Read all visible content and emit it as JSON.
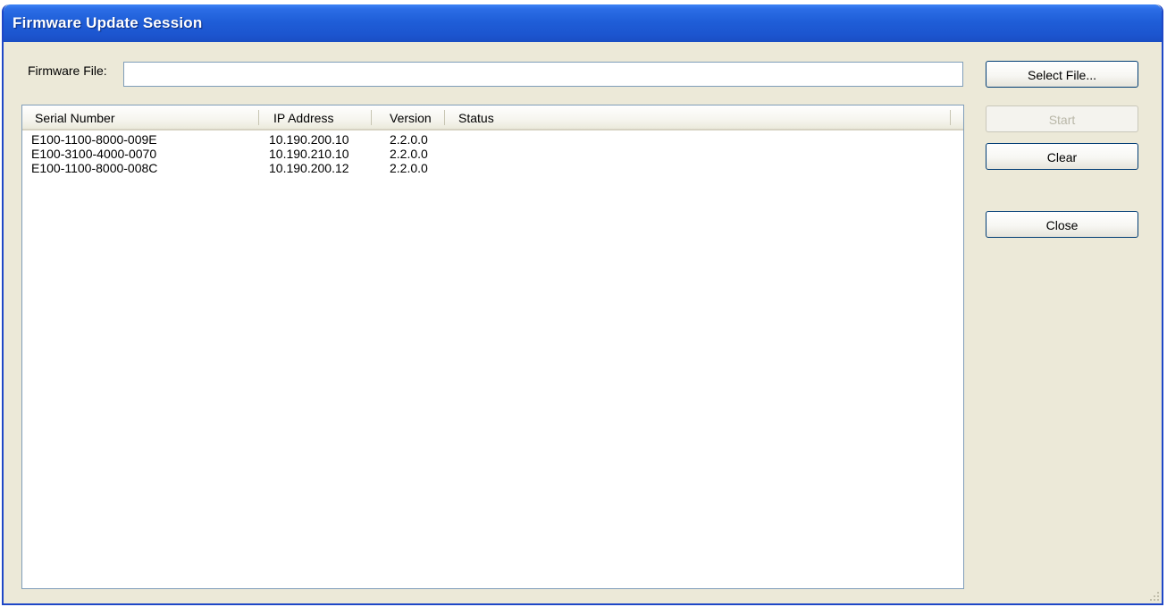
{
  "window": {
    "title": "Firmware Update Session"
  },
  "firmware": {
    "label": "Firmware File:",
    "value": "",
    "placeholder": ""
  },
  "list": {
    "columns": [
      "Serial Number",
      "IP Address",
      "Version",
      "Status"
    ],
    "rows": [
      {
        "serial": "E100-1100-8000-009E",
        "ip": "10.190.200.10",
        "version": "2.2.0.0",
        "status": ""
      },
      {
        "serial": "E100-3100-4000-0070",
        "ip": "10.190.210.10",
        "version": "2.2.0.0",
        "status": ""
      },
      {
        "serial": "E100-1100-8000-008C",
        "ip": "10.190.200.12",
        "version": "2.2.0.0",
        "status": ""
      }
    ]
  },
  "buttons": {
    "select_file": "Select File...",
    "start": "Start",
    "start_enabled": false,
    "clear": "Clear",
    "close": "Close"
  },
  "colors": {
    "titlebar": "#1f5ed8",
    "window_bg": "#ece9d8",
    "border": "#1e47c7"
  }
}
